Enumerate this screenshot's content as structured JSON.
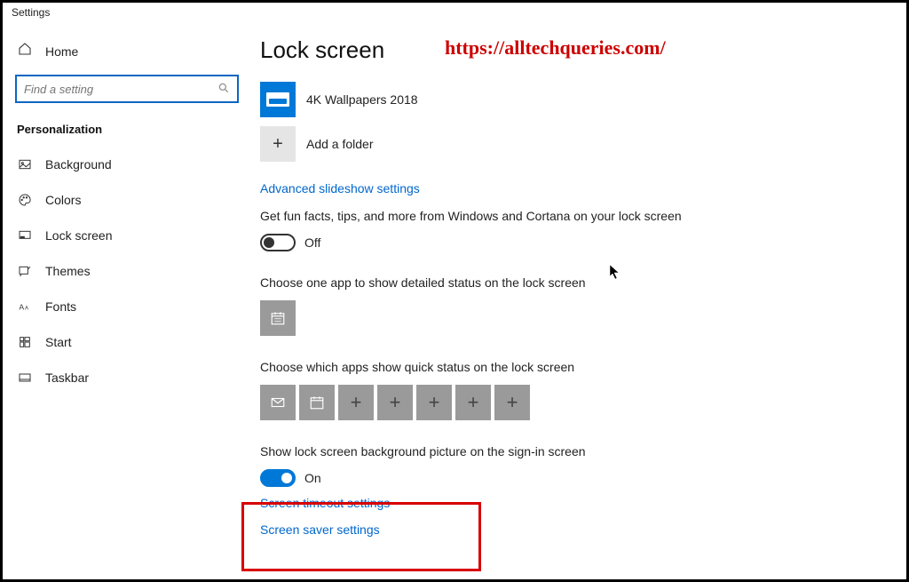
{
  "window": {
    "title": "Settings"
  },
  "watermark": "https://alltechqueries.com/",
  "sidebar": {
    "home_label": "Home",
    "search_placeholder": "Find a setting",
    "section_label": "Personalization",
    "items": [
      {
        "label": "Background"
      },
      {
        "label": "Colors"
      },
      {
        "label": "Lock screen"
      },
      {
        "label": "Themes"
      },
      {
        "label": "Fonts"
      },
      {
        "label": "Start"
      },
      {
        "label": "Taskbar"
      }
    ]
  },
  "main": {
    "title": "Lock screen",
    "wallpapers_app": "4K Wallpapers 2018",
    "add_folder": "Add a folder",
    "advanced_link": "Advanced slideshow settings",
    "fun_facts_text": "Get fun facts, tips, and more from Windows and Cortana on your lock screen",
    "fun_facts_state": "Off",
    "detailed_status_text": "Choose one app to show detailed status on the lock screen",
    "quick_status_text": "Choose which apps show quick status on the lock screen",
    "signin_picture_text": "Show lock screen background picture on the sign-in screen",
    "signin_picture_state": "On",
    "timeout_link": "Screen timeout settings",
    "saver_link": "Screen saver settings"
  }
}
